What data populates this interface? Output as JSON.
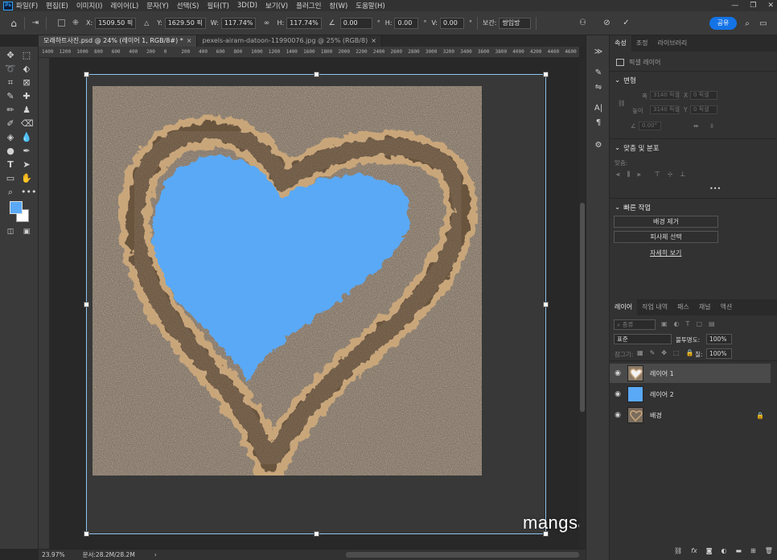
{
  "app": {
    "logo": "Ps",
    "menu": [
      "파일(F)",
      "편집(E)",
      "이미지(I)",
      "레이어(L)",
      "문자(Y)",
      "선택(S)",
      "필터(T)",
      "3D(D)",
      "보기(V)",
      "플러그인",
      "창(W)",
      "도움말(H)"
    ],
    "window_controls": [
      "—",
      "❐",
      "✕"
    ]
  },
  "options_bar": {
    "x_label": "X:",
    "x_value": "1509.50 픽",
    "y_label": "Y:",
    "y_value": "1629.50 픽",
    "w_label": "W:",
    "w_value": "117.74%",
    "h_label": "H:",
    "h_value": "117.74%",
    "angle_value": "0.00",
    "deg_symbol": "°",
    "hskew_label": "H:",
    "hskew_value": "0.00",
    "vskew_label": "V:",
    "vskew_value": "0.00",
    "interp_label": "보간:",
    "interp_value": "쌍입방",
    "share_label": "공유"
  },
  "tabs": [
    {
      "label": "모래하트사진.psd @ 24% (레이어 1, RGB/8#) *",
      "active": true
    },
    {
      "label": "pexels-airam-datoon-11990076.jpg @ 25% (RGB/8)",
      "active": false
    }
  ],
  "ruler": [
    "1400",
    "1200",
    "1000",
    "800",
    "600",
    "400",
    "200",
    "0",
    "200",
    "400",
    "600",
    "800",
    "1000",
    "1200",
    "1400",
    "1600",
    "1800",
    "2000",
    "2200",
    "2400",
    "2600",
    "2800",
    "3000",
    "3200",
    "3400",
    "3600",
    "3800",
    "4000",
    "4200",
    "4400",
    "4600"
  ],
  "status": {
    "zoom": "23.97%",
    "doc": "문서:28.2M/28.2M"
  },
  "watermark": "mangsangK.com",
  "colors": {
    "foreground": "#5aa9f6",
    "background": "#ffffff",
    "accent": "#1473e6",
    "heart_fill": "#5aa9f6"
  },
  "properties_panel": {
    "tabs": [
      "속성",
      "조정",
      "라이브러리"
    ],
    "layer_type": "픽셀 레이어",
    "transform_title": "변형",
    "w_label": "폭",
    "w_value": "3140 픽셀",
    "h_label": "높이",
    "h_value": "3140 픽셀",
    "x_label": "X",
    "x_value": "0 픽셀",
    "y_label": "Y",
    "y_value": "0 픽셀",
    "angle_value": "0.00°",
    "align_title": "맞춤 및 분포",
    "align_label": "맞춤:",
    "more": "•••",
    "quick_title": "빠른 작업",
    "remove_bg": "배경 제거",
    "select_subject": "피사체 선택",
    "see_more": "자세히 보기"
  },
  "layers_panel": {
    "tabs": [
      "레이어",
      "작업 내역",
      "패스",
      "채널",
      "액션"
    ],
    "filter_label": "종류",
    "blend_mode": "표준",
    "opacity_label": "불투명도:",
    "opacity_value": "100%",
    "lock_label": "잠그기:",
    "fill_label": "칠:",
    "fill_value": "100%",
    "layers": [
      {
        "name": "레이어 1",
        "selected": true,
        "locked": false
      },
      {
        "name": "레이어 2",
        "selected": false,
        "locked": false
      },
      {
        "name": "배경",
        "selected": false,
        "locked": true
      }
    ],
    "bottom_icons": [
      "link-icon",
      "fx-icon",
      "mask-icon",
      "adjustment-icon",
      "group-icon",
      "new-layer-icon",
      "trash-icon"
    ]
  }
}
